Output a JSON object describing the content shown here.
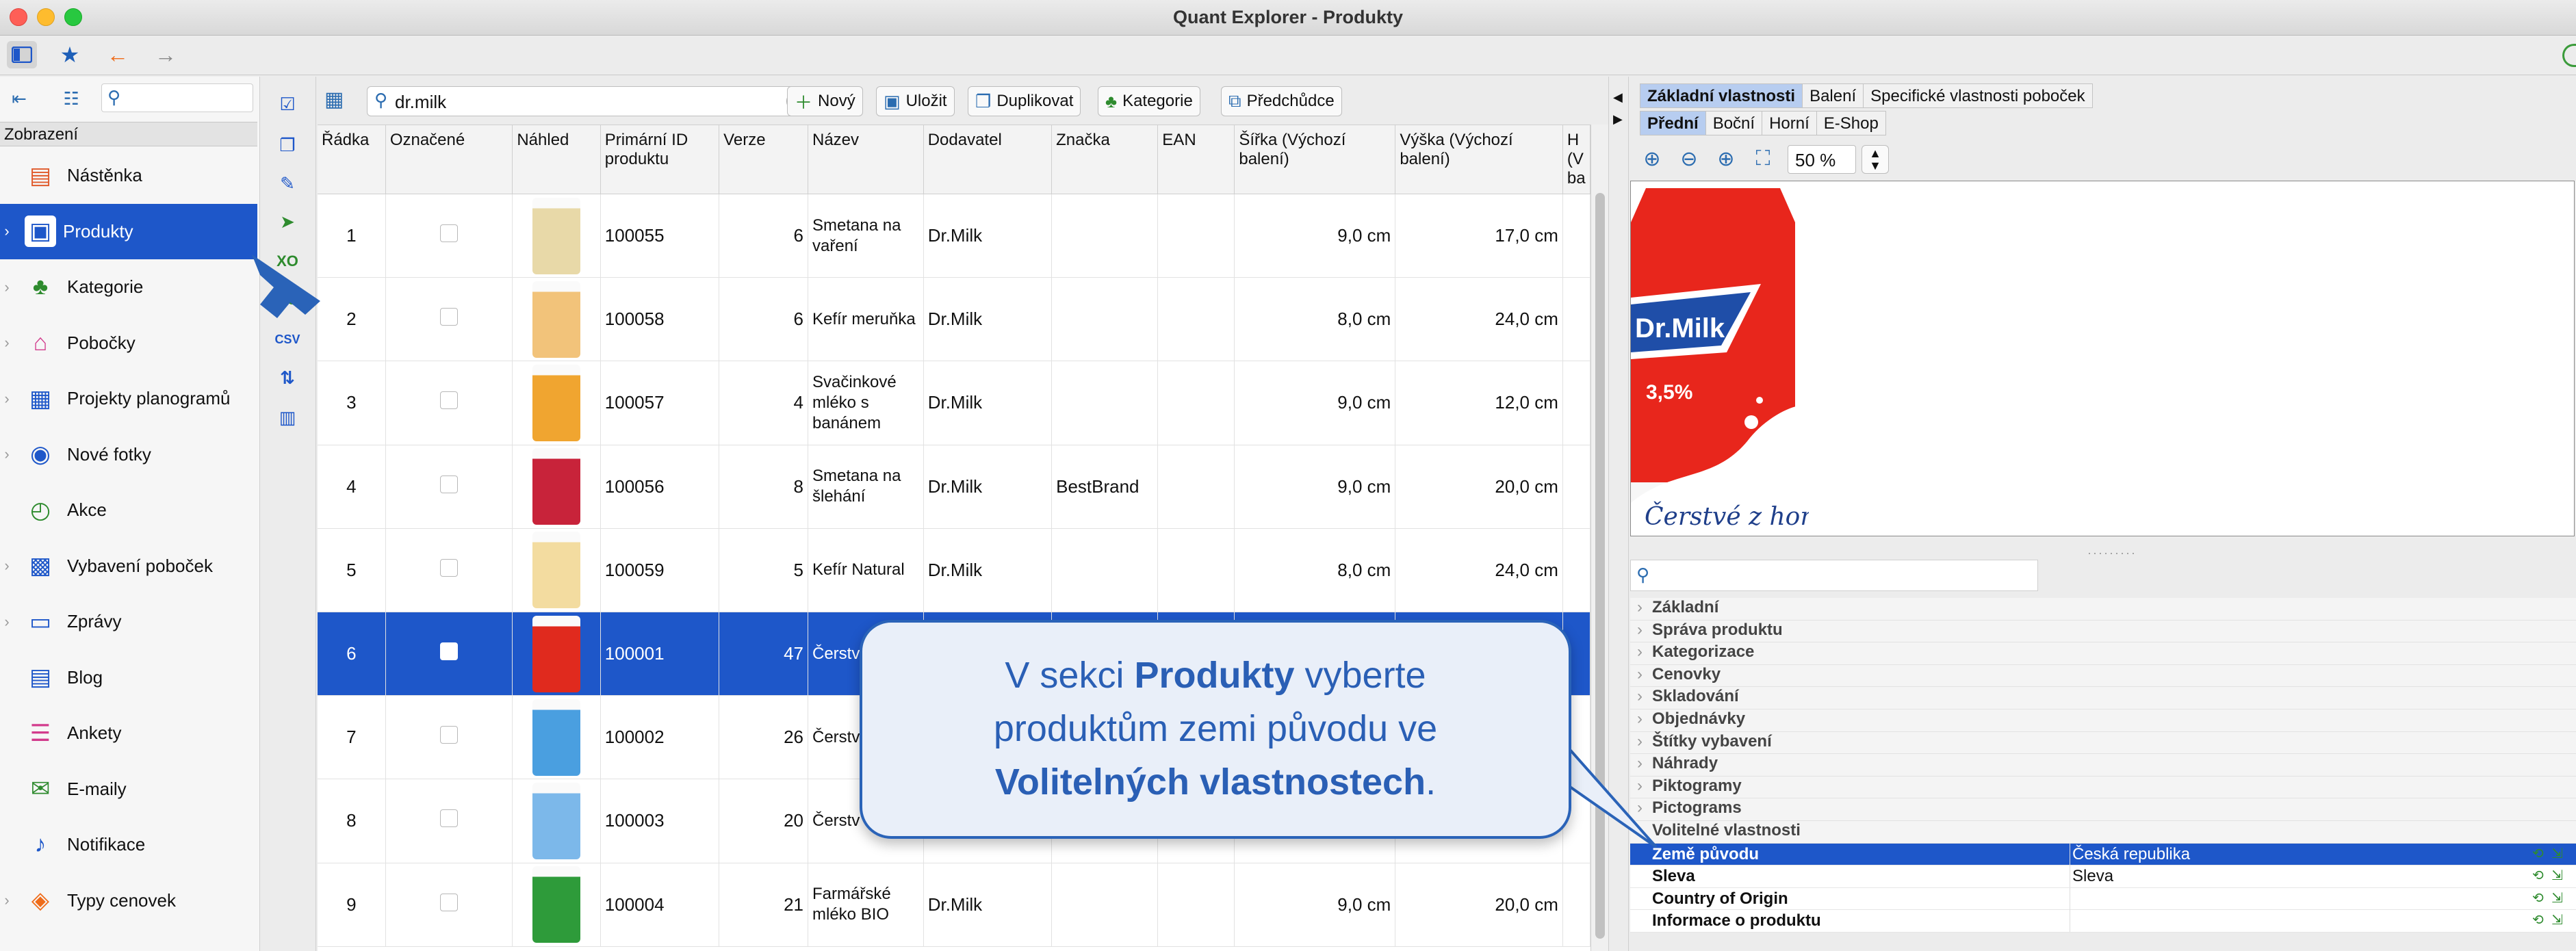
{
  "window": {
    "title": "Quant Explorer - Produkty"
  },
  "sidebar": {
    "search_placeholder": "",
    "section": "Zobrazení",
    "items": [
      {
        "label": "Nástěnka",
        "icon": "dashboard-icon",
        "color": "#e05a2b",
        "active": false,
        "chevron": false
      },
      {
        "label": "Produkty",
        "icon": "product-icon",
        "color": "#1e57c9",
        "active": true,
        "chevron": true
      },
      {
        "label": "Kategorie",
        "icon": "category-tree-icon",
        "color": "#2e8b2e",
        "active": false,
        "chevron": true
      },
      {
        "label": "Pobočky",
        "icon": "store-icon",
        "color": "#d23b8c",
        "active": false,
        "chevron": true
      },
      {
        "label": "Projekty planogramů",
        "icon": "planogram-icon",
        "color": "#1e57c9",
        "active": false,
        "chevron": true
      },
      {
        "label": "Nové fotky",
        "icon": "camera-icon",
        "color": "#1e57c9",
        "active": false,
        "chevron": true
      },
      {
        "label": "Akce",
        "icon": "clock-icon",
        "color": "#2e8b2e",
        "active": false,
        "chevron": false
      },
      {
        "label": "Vybavení poboček",
        "icon": "equipment-icon",
        "color": "#1e57c9",
        "active": false,
        "chevron": true
      },
      {
        "label": "Zprávy",
        "icon": "message-icon",
        "color": "#1e57c9",
        "active": false,
        "chevron": true
      },
      {
        "label": "Blog",
        "icon": "blog-icon",
        "color": "#1e57c9",
        "active": false,
        "chevron": false
      },
      {
        "label": "Ankety",
        "icon": "survey-icon",
        "color": "#d23b8c",
        "active": false,
        "chevron": false
      },
      {
        "label": "E-maily",
        "icon": "mail-icon",
        "color": "#2e8b2e",
        "active": false,
        "chevron": false
      },
      {
        "label": "Notifikace",
        "icon": "notification-icon",
        "color": "#1e57c9",
        "active": false,
        "chevron": false
      },
      {
        "label": "Typy cenovek",
        "icon": "price-tag-icon",
        "color": "#ef6c1a",
        "active": false,
        "chevron": true
      }
    ]
  },
  "toolbar": {
    "search_value": "dr.milk",
    "buttons": {
      "new": "Nový",
      "save": "Uložit",
      "duplicate": "Duplikovat",
      "category": "Kategorie",
      "predecessor": "Předchůdce"
    }
  },
  "table": {
    "headers": [
      "Řádka",
      "Označené",
      "Náhled",
      "Primární ID produktu",
      "Verze",
      "Název",
      "Dodavatel",
      "Značka",
      "EAN",
      "Šířka (Výchozí balení)",
      "Výška (Výchozí balení)",
      "H (V ba"
    ],
    "rows": [
      {
        "row": "1",
        "checked": false,
        "thumb": "#e8d9a8",
        "id": "100055",
        "version": "6",
        "name": "Smetana na vaření",
        "supplier": "Dr.Milk",
        "brand": "",
        "ean": "",
        "width": "9,0 cm",
        "height": "17,0 cm"
      },
      {
        "row": "2",
        "checked": false,
        "thumb": "#f2c37a",
        "id": "100058",
        "version": "6",
        "name": "Kefír meruňka",
        "supplier": "Dr.Milk",
        "brand": "",
        "ean": "",
        "width": "8,0 cm",
        "height": "24,0 cm"
      },
      {
        "row": "3",
        "checked": false,
        "thumb": "#f0a530",
        "id": "100057",
        "version": "4",
        "name": "Svačinkové mléko s banánem",
        "supplier": "Dr.Milk",
        "brand": "",
        "ean": "",
        "width": "9,0 cm",
        "height": "12,0 cm"
      },
      {
        "row": "4",
        "checked": false,
        "thumb": "#c8233a",
        "id": "100056",
        "version": "8",
        "name": "Smetana na šlehání",
        "supplier": "Dr.Milk",
        "brand": "BestBrand",
        "ean": "",
        "width": "9,0 cm",
        "height": "20,0 cm"
      },
      {
        "row": "5",
        "checked": false,
        "thumb": "#f3dca0",
        "id": "100059",
        "version": "5",
        "name": "Kefír Natural",
        "supplier": "Dr.Milk",
        "brand": "",
        "ean": "",
        "width": "8,0 cm",
        "height": "24,0 cm"
      },
      {
        "row": "6",
        "checked": true,
        "thumb": "#e02a1e",
        "id": "100001",
        "version": "47",
        "name": "Čerstvé plnotu",
        "supplier": "",
        "brand": "",
        "ean": "",
        "width": "",
        "height": "",
        "selected": true
      },
      {
        "row": "7",
        "checked": false,
        "thumb": "#4a9fe0",
        "id": "100002",
        "version": "26",
        "name": "Čerstv polotu",
        "supplier": "",
        "brand": "",
        "ean": "",
        "width": "",
        "height": ""
      },
      {
        "row": "8",
        "checked": false,
        "thumb": "#7cb8ea",
        "id": "100003",
        "version": "20",
        "name": "Čerstv nízkotu",
        "supplier": "",
        "brand": "",
        "ean": "",
        "width": "",
        "height": ""
      },
      {
        "row": "9",
        "checked": false,
        "thumb": "#2e9b3a",
        "id": "100004",
        "version": "21",
        "name": "Farmářské mléko BIO",
        "supplier": "Dr.Milk",
        "brand": "",
        "ean": "",
        "width": "9,0 cm",
        "height": "20,0 cm"
      }
    ]
  },
  "right_panel": {
    "tabs_top": [
      "Základní vlastnosti",
      "Balení",
      "Specifické vlastnosti poboček"
    ],
    "tabs_sub": [
      "Přední",
      "Boční",
      "Horní",
      "E-Shop"
    ],
    "zoom": "50 %",
    "preview": {
      "brand": "Dr.Milk",
      "fat": "3,5%",
      "slogan": "Čerstvé z hor"
    },
    "groups": [
      "Základní",
      "Správa produktu",
      "Kategorizace",
      "Cenovky",
      "Skladování",
      "Objednávky",
      "Štítky vybavení",
      "Náhrady",
      "Piktogramy",
      "Pictograms",
      "Volitelné vlastnosti"
    ],
    "properties": [
      {
        "name": "Země původu",
        "value": "Česká republika",
        "selected": true
      },
      {
        "name": "Sleva",
        "value": "Sleva",
        "selected": false
      },
      {
        "name": "Country of Origin",
        "value": "",
        "selected": false
      },
      {
        "name": "Informace o produktu",
        "value": "",
        "selected": false
      }
    ]
  },
  "callout": {
    "line1_pre": "V sekci ",
    "line1_bold": "Produkty",
    "line1_post": " vyberte",
    "line2": "produktům zemi původu ve",
    "line3_bold": "Volitelných vlastnostech",
    "line3_post": "."
  },
  "colors": {
    "accent": "#1e57c9",
    "callout_border": "#2a63b8",
    "callout_text": "#2a5fb5"
  }
}
